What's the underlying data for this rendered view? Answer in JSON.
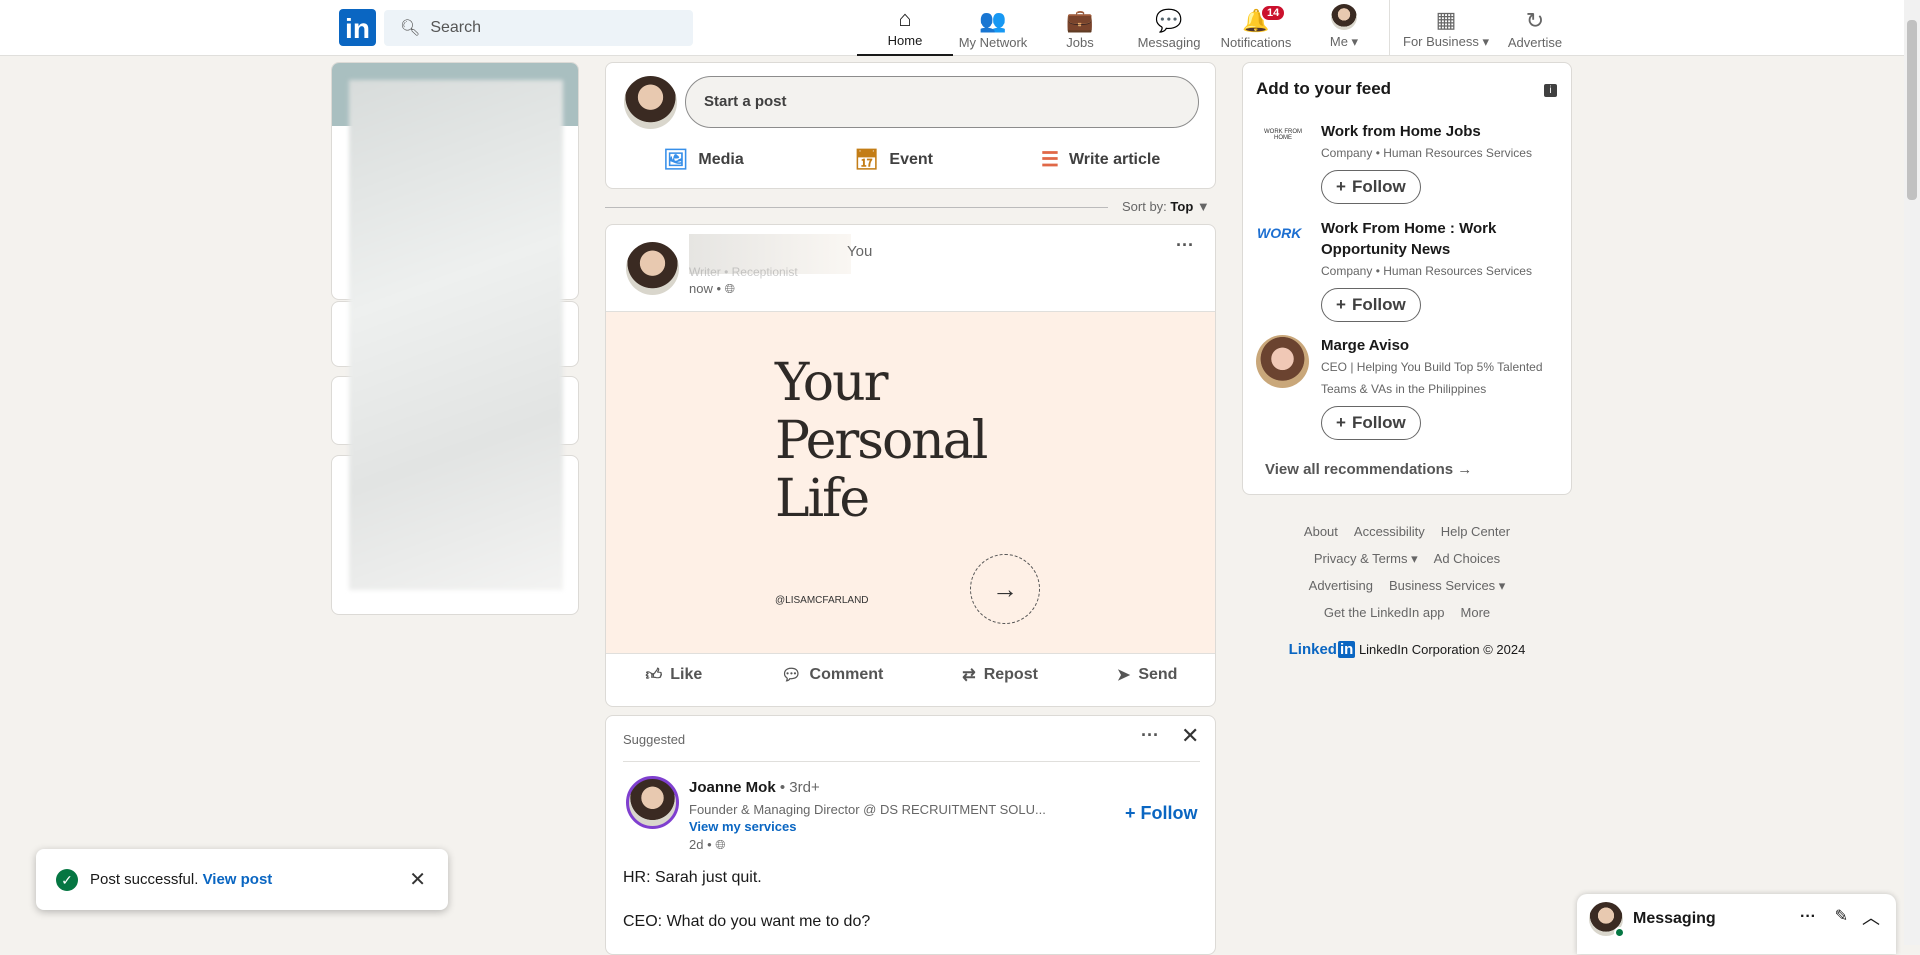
{
  "nav": {
    "logo": "in",
    "search_placeholder": "Search",
    "items": [
      {
        "label": "Home",
        "icon": "⌂"
      },
      {
        "label": "My Network",
        "icon": "👥"
      },
      {
        "label": "Jobs",
        "icon": "💼"
      },
      {
        "label": "Messaging",
        "icon": "💬"
      },
      {
        "label": "Notifications",
        "icon": "🔔",
        "badge": "14"
      },
      {
        "label": "Me ▾"
      },
      {
        "label": "For Business ▾",
        "icon": "▦"
      },
      {
        "label": "Advertise",
        "icon": "↻"
      }
    ]
  },
  "composer": {
    "placeholder": "Start a post",
    "media": "Media",
    "event": "Event",
    "article": "Write article"
  },
  "sort": {
    "label": "Sort by:",
    "value": "Top"
  },
  "post": {
    "you": "You",
    "headline": "Writer • Receptionist",
    "time": "now •",
    "image_title_1": "Your",
    "image_title_2": "Personal",
    "image_title_3": "Life",
    "image_handle": "@LISAMCFARLAND",
    "actions": [
      "Like",
      "Comment",
      "Repost",
      "Send"
    ]
  },
  "suggested": {
    "label": "Suggested",
    "name": "Joanne Mok",
    "degree": "• 3rd+",
    "headline": "Founder & Managing Director @ DS RECRUITMENT SOLU...",
    "link": "View my services",
    "time": "2d •",
    "follow": "Follow",
    "body_1": "HR: Sarah just quit.",
    "body_2": "CEO: What do you want me to do?"
  },
  "feed": {
    "title": "Add to your feed",
    "recs": [
      {
        "name": "Work from Home Jobs",
        "sub": "Company • Human Resources Services",
        "follow": "Follow"
      },
      {
        "name": "Work From Home : Work Opportunity News",
        "sub": "Company • Human Resources Services",
        "follow": "Follow"
      },
      {
        "name": "Marge Aviso",
        "sub": "CEO | Helping You Build Top 5% Talented Teams & VAs in the Philippines",
        "follow": "Follow"
      }
    ],
    "view_all": "View all recommendations →"
  },
  "footer": {
    "links": [
      "About",
      "Accessibility",
      "Help Center",
      "Privacy & Terms ▾",
      "Ad Choices",
      "Advertising",
      "Business Services ▾",
      "Get the LinkedIn app",
      "More"
    ],
    "brand": "Linked",
    "brand_in": "in",
    "copyright": "LinkedIn Corporation © 2024"
  },
  "toast": {
    "text": "Post successful.",
    "link": "View post"
  },
  "messaging": {
    "label": "Messaging"
  }
}
